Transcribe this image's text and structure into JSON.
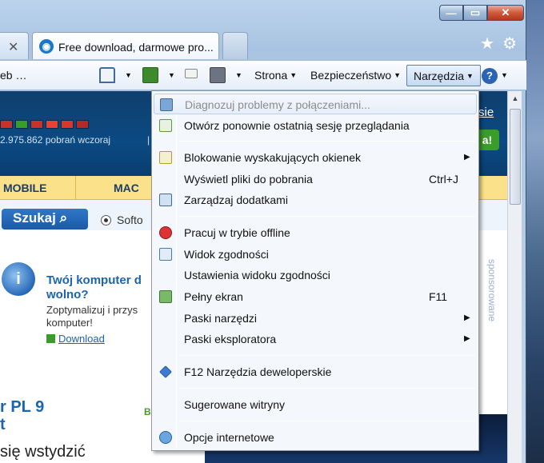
{
  "window": {
    "caption_buttons": {
      "minimize": "—",
      "maximize": "▭",
      "close": "✕"
    }
  },
  "tabs": {
    "left_tab_close": "✕",
    "active_tab_title": "Free download, darmowe pro...",
    "active_tab_icon": "globe-icon",
    "right_icons": {
      "favorites": "★",
      "tools": "⚙"
    }
  },
  "command_bar": {
    "left_fragment": "eb …",
    "strona": "Strona",
    "bezpieczenstwo": "Bezpieczeństwo",
    "narzedzia": "Narzędzia",
    "help": "?",
    "dropdown_arrow": "▼"
  },
  "page": {
    "downloads_text": "2.975.862 pobrań wczoraj",
    "downloads_sep": "|",
    "header_link": "sie",
    "header_green": "a!",
    "nav_tabs": [
      "MOBILE",
      "MAC"
    ],
    "search_button": "Szukaj",
    "search_radio_label": "Softo",
    "promo": {
      "title_line1": "Twój komputer d",
      "title_line2": "wolno?",
      "desc_line1": "Zoptymalizuj i przys",
      "desc_line2": "komputer!",
      "download": "Download"
    },
    "article": {
      "title_line1": "r PL 9",
      "title_line2": "t",
      "sub": "się wstydzić",
      "badge": "B"
    },
    "sponsored": "sponsorowane",
    "flag_colors": [
      "#c9312b",
      "#3a9c2a",
      "#c9312b",
      "#e94133",
      "#d9362c",
      "#b32a28"
    ]
  },
  "menu": {
    "items": [
      {
        "label": "Diagnozuj problemy z połączeniami...",
        "icon": "network-diagnose-icon",
        "disabled": true,
        "highlight": true,
        "key": "",
        "submenu": false
      },
      {
        "label": "Otwórz ponownie ostatnią sesję przeglądania",
        "icon": "reopen-session-icon",
        "disabled": false,
        "highlight": false,
        "key": "",
        "submenu": false
      },
      {
        "label": "Blokowanie wyskakujących okienek",
        "icon": "popup-blocker-icon",
        "disabled": false,
        "highlight": false,
        "key": "",
        "submenu": true
      },
      {
        "label": "Wyświetl pliki do pobrania",
        "icon": "",
        "disabled": false,
        "highlight": false,
        "key": "Ctrl+J",
        "submenu": false
      },
      {
        "label": "Zarządzaj dodatkami",
        "icon": "manage-addons-icon",
        "disabled": false,
        "highlight": false,
        "key": "",
        "submenu": false
      },
      {
        "label": "Pracuj w trybie offline",
        "icon": "offline-icon",
        "disabled": false,
        "highlight": false,
        "key": "",
        "submenu": false
      },
      {
        "label": "Widok zgodności",
        "icon": "compatibility-view-icon",
        "disabled": false,
        "highlight": false,
        "key": "",
        "submenu": false
      },
      {
        "label": "Ustawienia widoku zgodności",
        "icon": "",
        "disabled": false,
        "highlight": false,
        "key": "",
        "submenu": false
      },
      {
        "label": "Pełny ekran",
        "icon": "fullscreen-icon",
        "disabled": false,
        "highlight": false,
        "key": "F11",
        "submenu": false
      },
      {
        "label": "Paski narzędzi",
        "icon": "",
        "disabled": false,
        "highlight": false,
        "key": "",
        "submenu": true
      },
      {
        "label": "Paski eksploratora",
        "icon": "",
        "disabled": false,
        "highlight": false,
        "key": "",
        "submenu": true
      },
      {
        "label": "F12 Narzędzia deweloperskie",
        "icon": "developer-tools-icon",
        "disabled": false,
        "highlight": false,
        "key": "",
        "submenu": false
      },
      {
        "label": "Sugerowane witryny",
        "icon": "",
        "disabled": false,
        "highlight": false,
        "key": "",
        "submenu": false
      },
      {
        "label": "Opcje internetowe",
        "icon": "internet-options-icon",
        "disabled": false,
        "highlight": false,
        "key": "",
        "submenu": false
      }
    ],
    "submenu_arrow": "▶"
  }
}
